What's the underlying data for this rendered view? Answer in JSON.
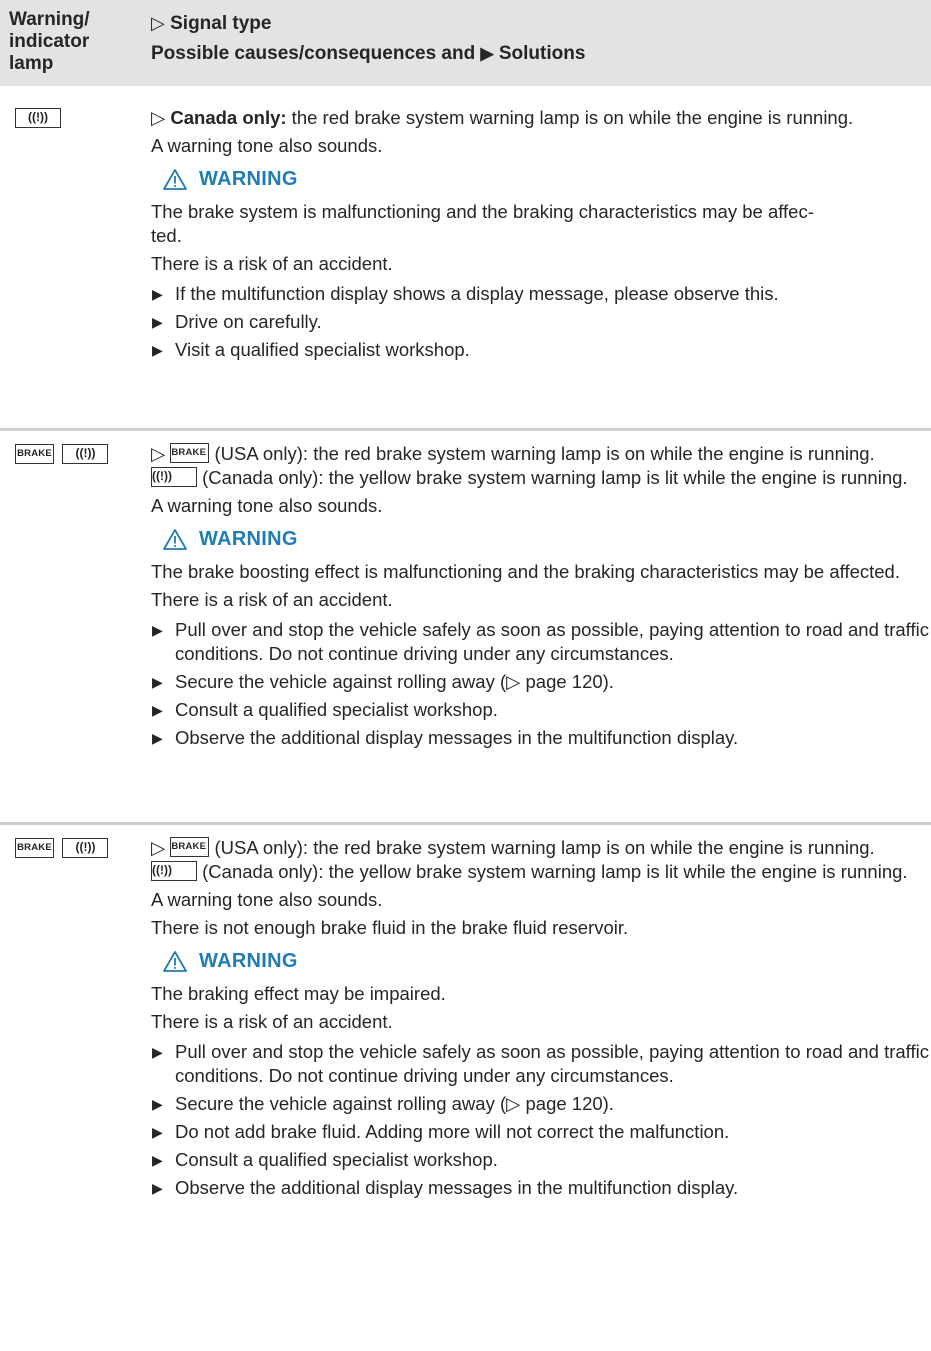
{
  "header": {
    "col1": [
      "Warning/",
      "indicator",
      "lamp"
    ],
    "col2_line1": "Signal type",
    "col2_line2_part1": "Possible causes/consequences and",
    "col2_line2_part2": "Solutions"
  },
  "lamp_labels": {
    "brake": "BRAKE",
    "circle_icon": "brake-warning-circle-icon"
  },
  "colors": {
    "accent": "#1f7cb4",
    "header_bg": "#e3e3e3",
    "separator": "#cfcfcf",
    "text": "#262626"
  },
  "rows": [
    {
      "intro_bold": "Canada only:",
      "intro_rest": " the red brake system warning lamp is on while the engine is running.",
      "tone": "A warning tone also sounds.",
      "warning_title": "WARNING",
      "warning_text": "The brake system is malfunctioning and the braking characteristics may be affec- ted.",
      "risk": "There is a risk of an accident.",
      "steps": [
        "If the multifunction display shows a display message, please observe this.",
        "Drive on carefully.",
        "Visit a qualified specialist workshop."
      ]
    },
    {
      "usa_text": " (USA only): the red brake system warning lamp is on while the engine is running.",
      "canada_text": " (Canada only): the yellow brake system warning lamp is lit while the engine is running.",
      "tone": "A warning tone also sounds.",
      "warning_title": "WARNING",
      "warning_text": "The brake boosting effect is malfunctioning and the braking characteristics may be affected.",
      "risk": "There is a risk of an accident.",
      "steps": [
        "Pull over and stop the vehicle safely as soon as possible, paying attention to road and traffic conditions. Do not continue driving under any circumstances.",
        "Secure the vehicle against rolling away (▷ page 120).",
        "Consult a qualified specialist workshop.",
        "Observe the additional display messages in the multifunction display."
      ]
    },
    {
      "usa_text": " (USA only): the red brake system warning lamp is on while the engine is running.",
      "canada_text": " (Canada only): the yellow brake system warning lamp is lit while the engine is running.",
      "tone": "A warning tone also sounds.",
      "fluid": "There is not enough brake fluid in the brake fluid reservoir.",
      "warning_title": "WARNING",
      "warning_text": "The braking effect may be impaired.",
      "risk": "There is a risk of an accident.",
      "steps": [
        "Pull over and stop the vehicle safely as soon as possible, paying attention to road and traffic conditions. Do not continue driving under any circumstances.",
        "Secure the vehicle against rolling away (▷ page 120).",
        "Do not add brake fluid. Adding more will not correct the malfunction.",
        "Consult a qualified specialist workshop.",
        "Observe the additional display messages in the multifunction display."
      ]
    }
  ]
}
